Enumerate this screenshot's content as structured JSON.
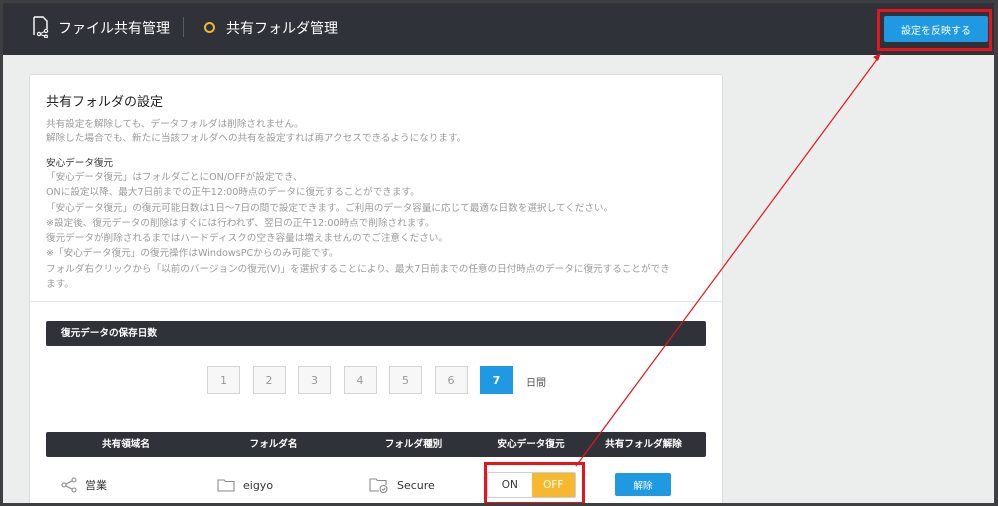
{
  "header": {
    "crumb_icon": "shared-file-icon",
    "crumb_1": "ファイル共有管理",
    "crumb_2": "共有フォルダ管理",
    "apply_button": "設定を反映する",
    "colors": {
      "bar": "#2f3239",
      "accent": "#1f9ae2",
      "dot": "#f2b632",
      "highlight": "#e8141b"
    }
  },
  "card": {
    "title": "共有フォルダの設定",
    "desc_lines": [
      "共有設定を解除しても、データフォルダは削除されません。",
      "解除した場合でも、新たに当該フォルダへの共有を設定すれば再アクセスできるようになります。"
    ],
    "subtitle": "安心データ復元",
    "desc2_lines": [
      "「安心データ復元」はフォルダごとにON/OFFが設定でき、",
      "ONに設定以降、最大7日前までの正午12:00時点のデータに復元することができます。",
      "「安心データ復元」の復元可能日数は1日〜7日の間で設定できます。ご利用のデータ容量に応じて最適な日数を選択してください。",
      "※設定後、復元データの削除はすぐには行われず、翌日の正午12:00時点で削除されます。",
      "復元データが削除されるまではハードディスクの空き容量は増えませんのでご注意ください。",
      "※「安心データ復元」の復元操作はWindowsPCからのみ可能です。",
      "フォルダ右クリックから「以前のバージョンの復元(V)」を選択することにより、最大7日前までの任意の日付時点のデータに復元することができ",
      "ます。"
    ]
  },
  "retention": {
    "section_title": "復元データの保存日数",
    "pages": [
      "1",
      "2",
      "3",
      "4",
      "5",
      "6",
      "7"
    ],
    "selected": "7",
    "unit": "日間"
  },
  "table": {
    "headers": [
      "共有領域名",
      "フォルダ名",
      "フォルダ種別",
      "安心データ復元",
      "共有フォルダ解除"
    ],
    "rows": [
      {
        "share_name": "営業",
        "share_icon": "share-icon",
        "folder_name": "eigyo",
        "folder_icon": "folder-icon",
        "folder_type": "Secure",
        "folder_type_icon": "secure-folder-icon",
        "toggle_on": "ON",
        "toggle_off": "OFF",
        "toggle_state": "OFF",
        "release_label": "解除"
      }
    ]
  }
}
